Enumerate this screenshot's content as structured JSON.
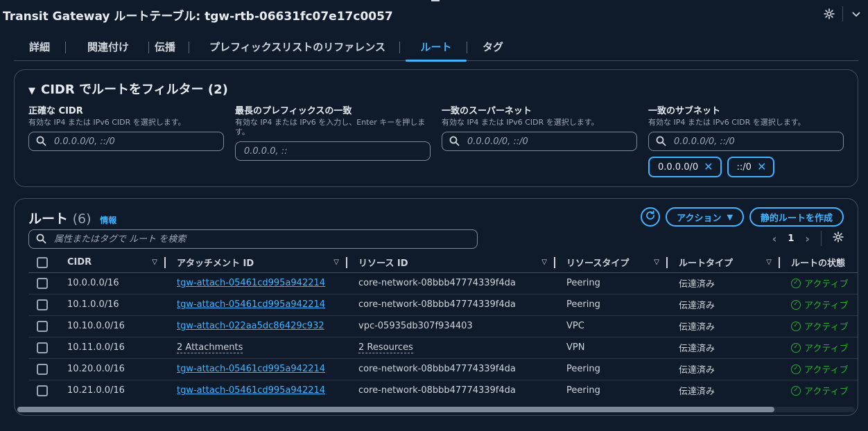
{
  "header": {
    "title": "Transit Gateway ルートテーブル: tgw-rtb-06631fc07e17c0057"
  },
  "tabs": [
    {
      "label": "詳細"
    },
    {
      "label": "関連付け"
    },
    {
      "label": "伝播"
    },
    {
      "label": "プレフィックスリストのリファレンス"
    },
    {
      "label": "ルート",
      "active": true
    },
    {
      "label": "タグ"
    }
  ],
  "filter": {
    "heading": "CIDR でルートをフィルター (2)",
    "fields": [
      {
        "label": "正確な CIDR",
        "desc": "有効な IP4 または IPv6 CIDR を選択します。",
        "placeholder": "0.0.0.0/0, ::/0"
      },
      {
        "label": "最長のプレフィックスの一致",
        "desc": "有効な IP4 または IPv6 を入力し、Enter キーを押します。",
        "placeholder": "0.0.0.0, ::"
      },
      {
        "label": "一致のスーパーネット",
        "desc": "有効な IP4 または IPv6 CIDR を選択します。",
        "placeholder": "0.0.0.0/0, ::/0"
      },
      {
        "label": "一致のサブネット",
        "desc": "有効な IP4 または IPv6 CIDR を選択します。",
        "placeholder": "0.0.0.0/0, ::/0"
      }
    ],
    "tokens": [
      "0.0.0.0/0",
      "::/0"
    ]
  },
  "routes": {
    "title": "ルート",
    "count": "(6)",
    "info": "情報",
    "actions_label": "アクション",
    "create_label": "静的ルートを作成",
    "search_placeholder": "属性またはタグで ルート を検索",
    "page": "1",
    "columns": [
      "CIDR",
      "アタッチメント ID",
      "リソース ID",
      "リソースタイプ",
      "ルートタイプ",
      "ルートの状態"
    ],
    "rows": [
      {
        "cidr": "10.0.0.0/16",
        "attachment": "tgw-attach-05461cd995a942214",
        "resource": "core-network-08bbb47774339f4da",
        "rtype": "Peering",
        "route_type": "伝達済み",
        "state": "アクティブ"
      },
      {
        "cidr": "10.1.0.0/16",
        "attachment": "tgw-attach-05461cd995a942214",
        "resource": "core-network-08bbb47774339f4da",
        "rtype": "Peering",
        "route_type": "伝達済み",
        "state": "アクティブ"
      },
      {
        "cidr": "10.10.0.0/16",
        "attachment": "tgw-attach-022aa5dc86429c932",
        "resource": "vpc-05935db307f934403",
        "rtype": "VPC",
        "route_type": "伝達済み",
        "state": "アクティブ"
      },
      {
        "cidr": "10.11.0.0/16",
        "attachment": "2 Attachments",
        "resource": "2 Resources",
        "rtype": "VPN",
        "route_type": "伝達済み",
        "state": "アクティブ"
      },
      {
        "cidr": "10.20.0.0/16",
        "attachment": "tgw-attach-05461cd995a942214",
        "resource": "core-network-08bbb47774339f4da",
        "rtype": "Peering",
        "route_type": "伝達済み",
        "state": "アクティブ"
      },
      {
        "cidr": "10.21.0.0/16",
        "attachment": "tgw-attach-05461cd995a942214",
        "resource": "core-network-08bbb47774339f4da",
        "rtype": "Peering",
        "route_type": "伝達済み",
        "state": "アクティブ"
      }
    ]
  },
  "colors": {
    "background": "#0f1b2a",
    "accent": "#42b4ff",
    "success": "#29ad32",
    "border": "#414d5c"
  },
  "icons": [
    "gear-icon",
    "chevron-down-icon",
    "search-icon",
    "close-icon",
    "refresh-icon",
    "caret-down-icon",
    "chevron-left-icon",
    "chevron-right-icon",
    "status-ok-icon"
  ]
}
